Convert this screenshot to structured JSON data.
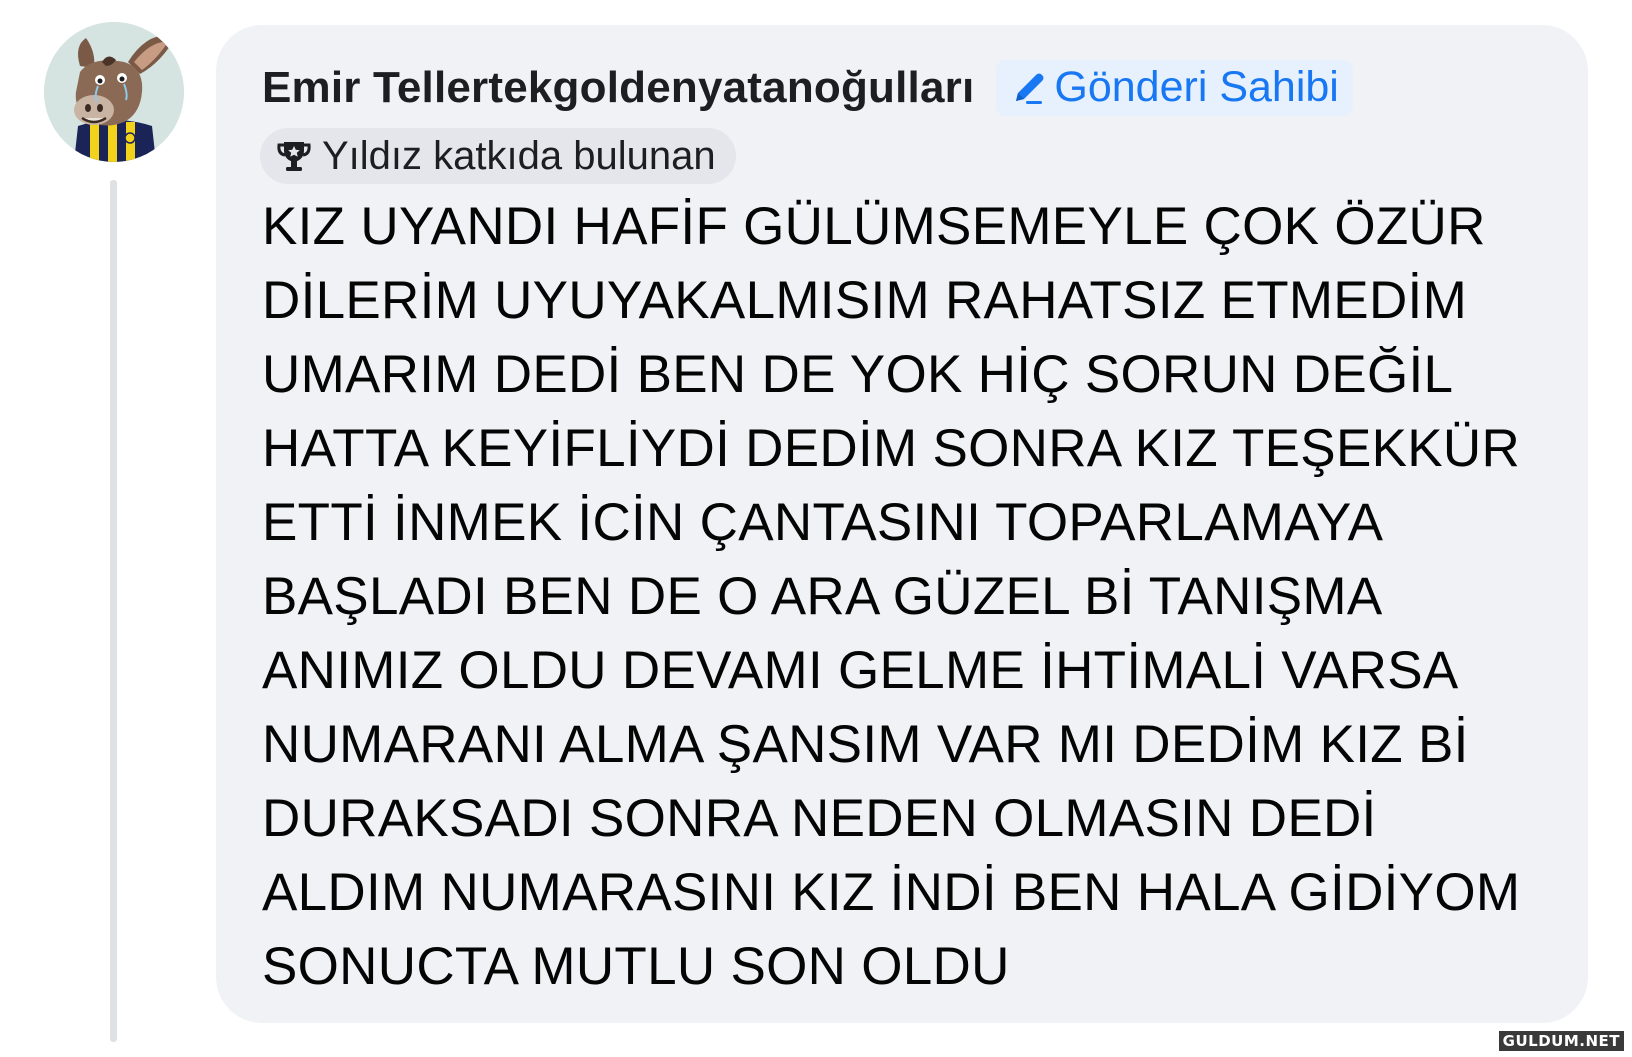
{
  "comment": {
    "author": "Emir Tellertekgoldenyatanoğulları",
    "owner_badge": {
      "label": "Gönderi Sahibi",
      "icon": "pencil-icon",
      "color": "#1877f2"
    },
    "contributor_badge": {
      "label": "Yıldız katkıda bulunan",
      "icon": "trophy-icon"
    },
    "avatar": {
      "icon": "donkey-avatar"
    },
    "text_lines": [
      "KIZ UYANDI HAFİF GÜLÜMSEMEYLE ÇOK ÖZÜR",
      "DİLERİM UYUYAKALMISIM RAHATSIZ ETMEDİM",
      "UMARIM DEDİ BEN DE YOK HİÇ SORUN DEĞİL",
      "HATTA KEYİFLİYDİ DEDİM SONRA KIZ TEŞEKKÜR",
      "ETTİ İNMEK İCİN ÇANTASINI TOPARLAMAYA",
      "BAŞLADI BEN DE O ARA GÜZEL Bİ TANIŞMA",
      "ANIMIZ OLDU DEVAMI GELME İHTİMALİ VARSA",
      "NUMARANI ALMA ŞANSIM VAR MI DEDİM KIZ Bİ",
      "DURAKSADI SONRA NEDEN OLMASIN DEDİ",
      "ALDIM NUMARASINI KIZ İNDİ BEN HALA GİDİYOM",
      "SONUCTA MUTLU SON OLDU"
    ]
  },
  "watermark": "GULDUM.NET",
  "colors": {
    "bubble_bg": "#f0f2f5",
    "accent": "#1877f2",
    "text": "#050505"
  }
}
